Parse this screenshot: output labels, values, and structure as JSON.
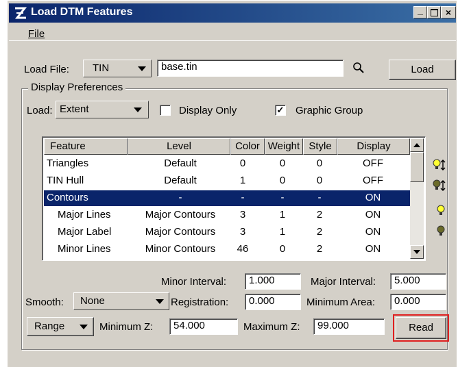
{
  "window": {
    "title": "Load DTM Features"
  },
  "menu": {
    "file": "File"
  },
  "load_file": {
    "label": "Load File:",
    "type_value": "TIN",
    "file_value": "base.tin",
    "load_button": "Load"
  },
  "display_prefs": {
    "group_label": "Display Preferences",
    "load_label": "Load:",
    "load_value": "Extent",
    "display_only_label": "Display Only",
    "display_only_checked": false,
    "graphic_group_label": "Graphic Group",
    "graphic_group_checked": true
  },
  "table": {
    "headers": [
      "Feature",
      "Level",
      "Color",
      "Weight",
      "Style",
      "Display"
    ],
    "rows": [
      {
        "feature": "Triangles",
        "level": "Default",
        "color": "0",
        "weight": "0",
        "style": "0",
        "display": "OFF"
      },
      {
        "feature": "TIN Hull",
        "level": "Default",
        "color": "1",
        "weight": "0",
        "style": "0",
        "display": "OFF"
      },
      {
        "feature": "Contours",
        "level": "-",
        "color": "-",
        "weight": "-",
        "style": "-",
        "display": "ON"
      },
      {
        "feature": "Major Lines",
        "level": "Major Contours",
        "color": "3",
        "weight": "1",
        "style": "2",
        "display": "ON"
      },
      {
        "feature": "Major Label",
        "level": "Major Contours",
        "color": "3",
        "weight": "1",
        "style": "2",
        "display": "ON"
      },
      {
        "feature": "Minor Lines",
        "level": "Minor Contours",
        "color": "46",
        "weight": "0",
        "style": "2",
        "display": "ON"
      }
    ],
    "selected_row": 2
  },
  "fields": {
    "minor_interval_label": "Minor Interval:",
    "minor_interval_value": "1.000",
    "major_interval_label": "Major Interval:",
    "major_interval_value": "5.000",
    "smooth_label": "Smooth:",
    "smooth_value": "None",
    "registration_label": "Registration:",
    "registration_value": "0.000",
    "minimum_area_label": "Minimum Area:",
    "minimum_area_value": "0.000",
    "range_label": "Range",
    "minimum_z_label": "Minimum Z:",
    "minimum_z_value": "54.000",
    "maximum_z_label": "Maximum Z:",
    "maximum_z_value": "99.000",
    "read_button": "Read"
  },
  "colors": {
    "titlebar": "#0a246a",
    "selection": "#0a246a",
    "highlight": "#e02020",
    "face": "#d4d0c8"
  }
}
